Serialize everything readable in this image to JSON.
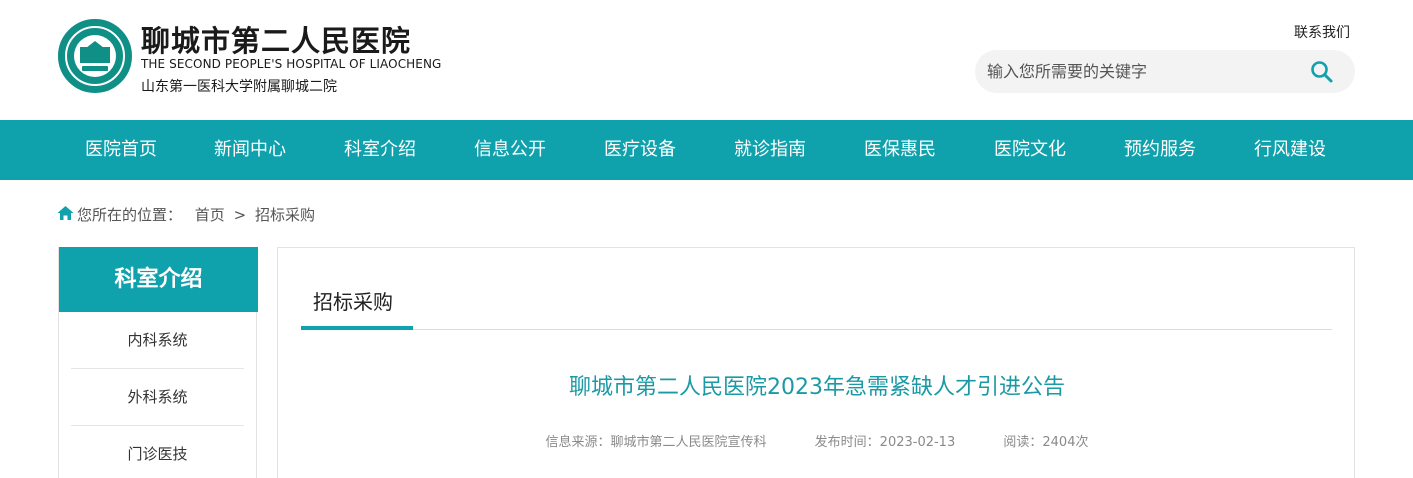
{
  "header": {
    "name": "聊城市第二人民医院",
    "name_en": "THE SECOND PEOPLE'S HOSPITAL OF LIAOCHENG",
    "subtitle": "山东第一医科大学附属聊城二院",
    "contact": "联系我们",
    "search_placeholder": "输入您所需要的关键字"
  },
  "nav": [
    "医院首页",
    "新闻中心",
    "科室介绍",
    "信息公开",
    "医疗设备",
    "就诊指南",
    "医保惠民",
    "医院文化",
    "预约服务",
    "行风建设"
  ],
  "breadcrumb": {
    "prefix": "您所在的位置：",
    "home": "首页",
    "sep": ">",
    "current": "招标采购"
  },
  "sidebar": {
    "title": "科室介绍",
    "items": [
      "内科系统",
      "外科系统",
      "门诊医技"
    ]
  },
  "content": {
    "tab": "招标采购",
    "article_title": "聊城市第二人民医院2023年急需紧缺人才引进公告",
    "source": "信息来源：聊城市第二人民医院宣传科",
    "date": "发布时间：2023-02-13",
    "views": "阅读：2404次"
  },
  "colors": {
    "accent": "#0fa1ac",
    "logo": "#0f8f86",
    "title": "#1b9aa5"
  }
}
